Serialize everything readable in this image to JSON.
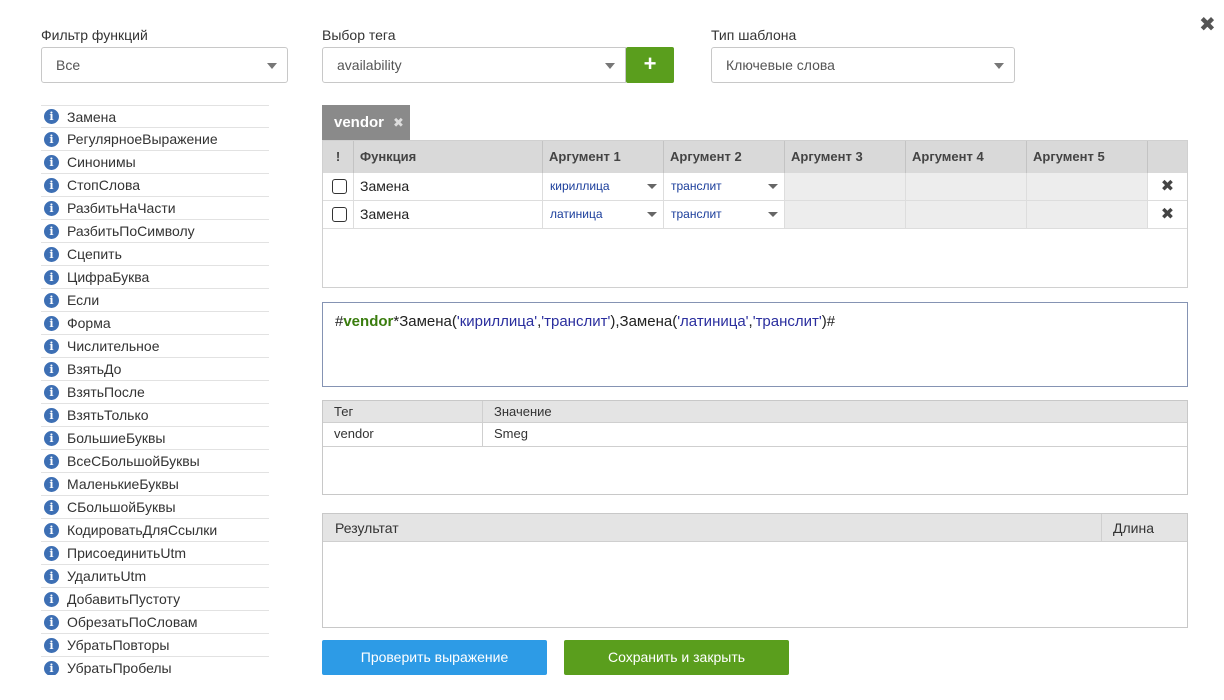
{
  "dialog": {
    "close_icon": "close-icon"
  },
  "filter": {
    "label": "Фильтр функций",
    "value": "Все"
  },
  "tag_select": {
    "label": "Выбор тега",
    "value": "availability",
    "add_label": "+"
  },
  "template_type": {
    "label": "Тип шаблона",
    "value": "Ключевые слова"
  },
  "functions": [
    "Замена",
    "РегулярноеВыражение",
    "Синонимы",
    "СтопСлова",
    "РазбитьНаЧасти",
    "РазбитьПоСимволу",
    "Сцепить",
    "ЦифраБуква",
    "Если",
    "Форма",
    "Числительное",
    "ВзятьДо",
    "ВзятьПосле",
    "ВзятьТолько",
    "БольшиеБуквы",
    "ВсеСБольшойБуквы",
    "МаленькиеБуквы",
    "СБольшойБуквы",
    "КодироватьДляСсылки",
    "ПрисоединитьUtm",
    "УдалитьUtm",
    "ДобавитьПустоту",
    "ОбрезатьПоСловам",
    "УбратьПовторы",
    "УбратьПробелы"
  ],
  "tag_tab": {
    "name": "vendor",
    "close": "✖"
  },
  "func_table": {
    "headers": {
      "flag": "!",
      "function": "Функция",
      "arg1": "Аргумент 1",
      "arg2": "Аргумент 2",
      "arg3": "Аргумент 3",
      "arg4": "Аргумент 4",
      "arg5": "Аргумент 5"
    },
    "rows": [
      {
        "function": "Замена",
        "arg1": "кириллица",
        "arg2": "транслит",
        "delete": "✖"
      },
      {
        "function": "Замена",
        "arg1": "латиница",
        "arg2": "транслит",
        "delete": "✖"
      }
    ]
  },
  "expression": {
    "p1": "#",
    "tag": "vendor",
    "p2": "*Замена(",
    "a1": "'кириллица'",
    "p3": ",",
    "a2": "'транслит'",
    "p4": "),Замена(",
    "a3": "'латиница'",
    "p5": ",",
    "a4": "'транслит'",
    "p6": ")#"
  },
  "tag_table": {
    "headers": {
      "tag": "Тег",
      "value": "Значение"
    },
    "rows": [
      {
        "tag": "vendor",
        "value": "Smeg"
      }
    ]
  },
  "result_table": {
    "headers": {
      "result": "Результат",
      "length": "Длина"
    }
  },
  "buttons": {
    "check": "Проверить выражение",
    "save": "Сохранить и закрыть"
  }
}
